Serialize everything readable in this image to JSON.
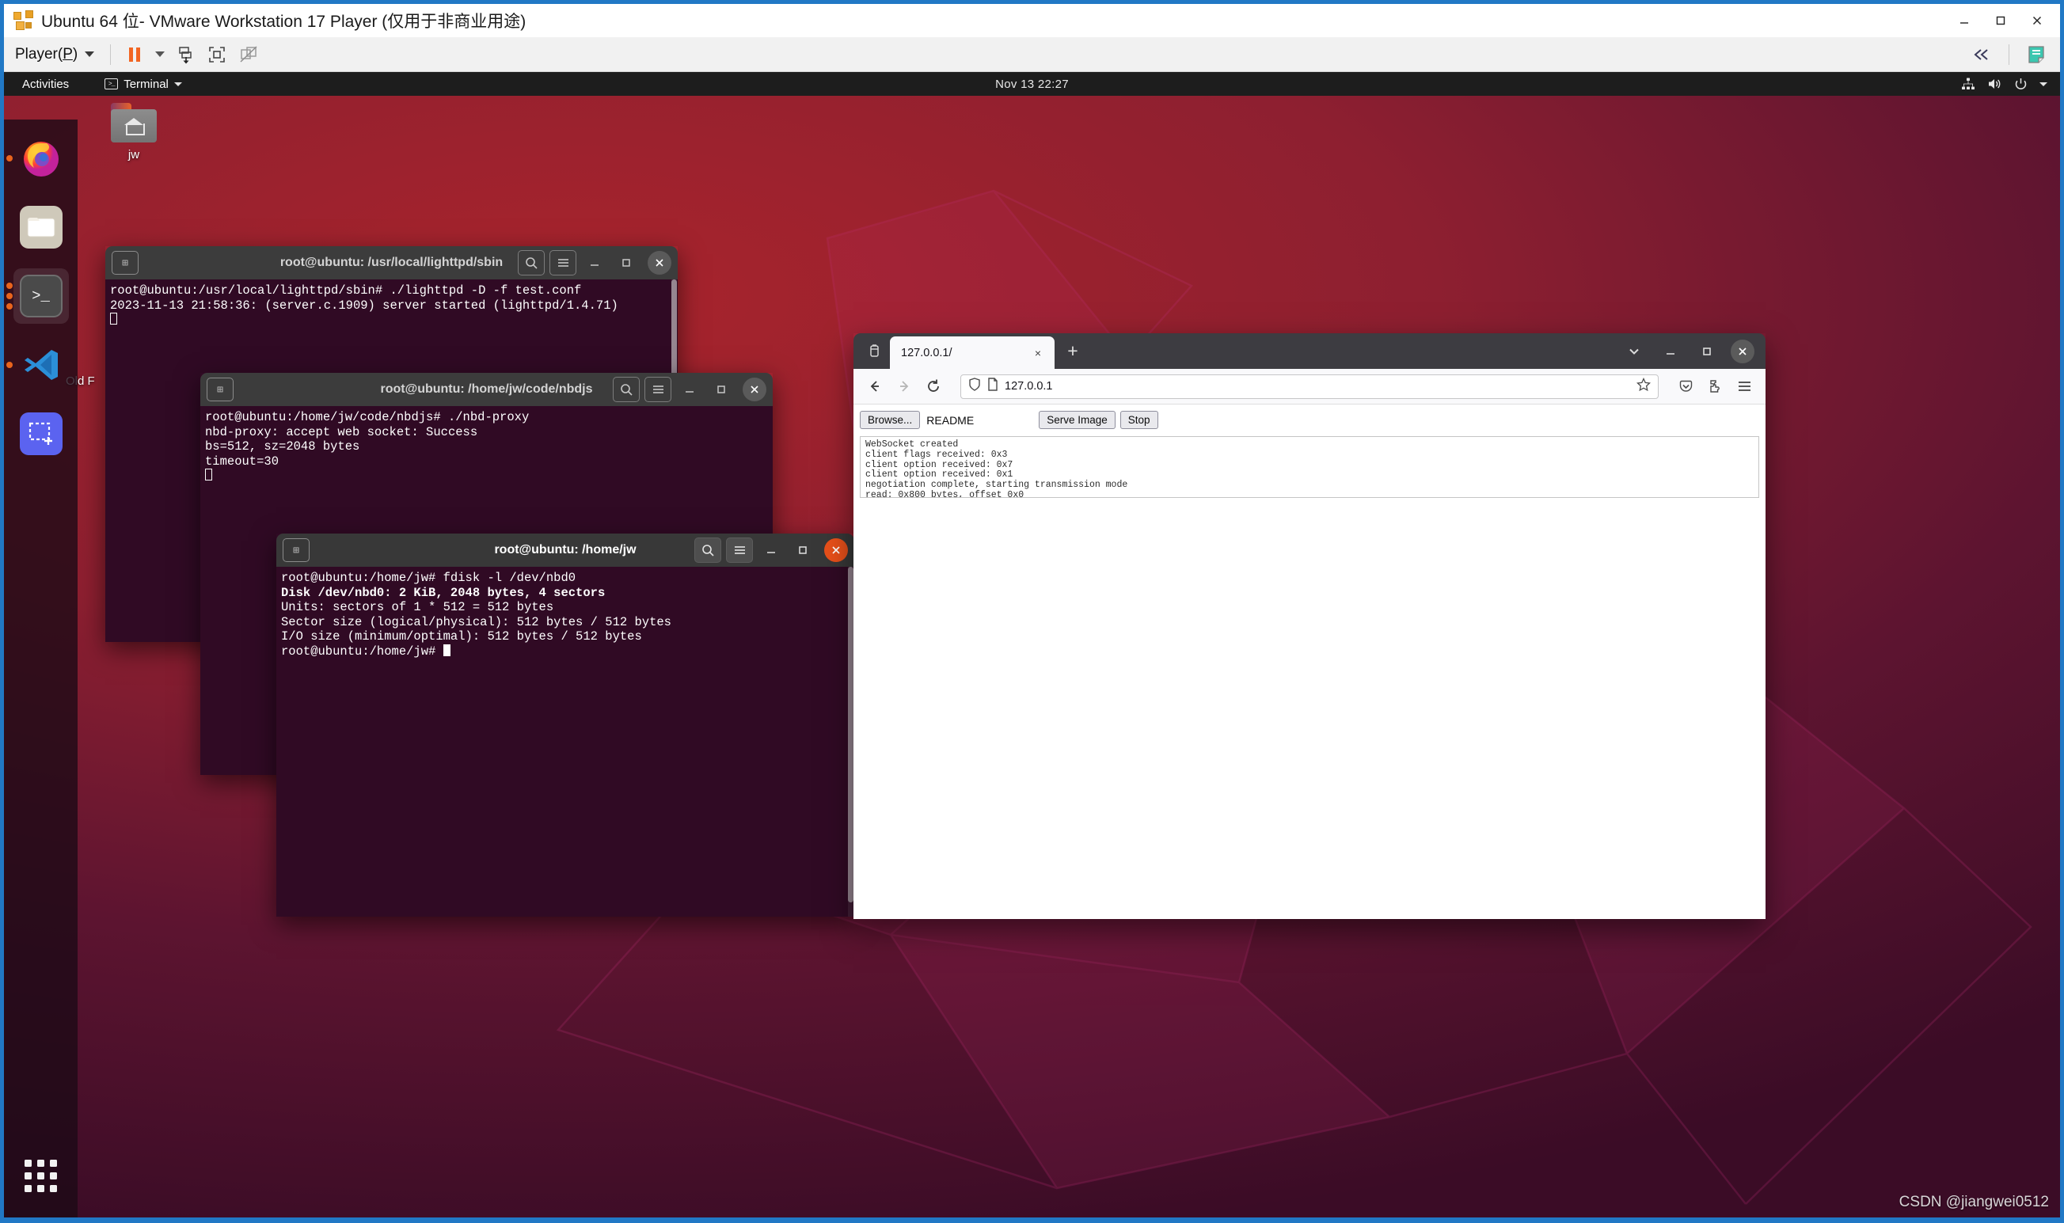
{
  "vmware": {
    "title": "Ubuntu 64 位- VMware Workstation 17 Player (仅用于非商业用途)",
    "menu_label_pre": "Player(",
    "menu_label_key": "P",
    "menu_label_post": ")",
    "icons": {
      "app": "vmware-logo-icon",
      "pause": "pause-icon",
      "dropdown": "caret-down-icon",
      "snapshot": "send-ctrl-alt-del-icon",
      "fullscreen": "enter-fullscreen-icon",
      "unity": "unity-mode-disabled-icon",
      "collapse": "collapse-toolbar-icon",
      "help": "help-notes-icon",
      "minimize": "minimize-icon",
      "maximize": "maximize-icon",
      "close": "close-icon"
    }
  },
  "gnome": {
    "activities": "Activities",
    "app_menu": "Terminal",
    "clock": "Nov 13  22:27",
    "tray": [
      "network-icon",
      "volume-icon",
      "power-icon",
      "caret-down-icon"
    ]
  },
  "dock": {
    "items": [
      {
        "name": "firefox",
        "label": "Firefox",
        "running": true,
        "dots": 1,
        "active": false
      },
      {
        "name": "files",
        "label": "Files",
        "running": false,
        "dots": 0,
        "active": false
      },
      {
        "name": "terminal",
        "label": "Terminal",
        "running": true,
        "dots": 3,
        "active": true
      },
      {
        "name": "vscode",
        "label": "Visual Studio Code",
        "running": true,
        "dots": 1,
        "active": false
      },
      {
        "name": "screenshot",
        "label": "Screenshot",
        "running": false,
        "dots": 0,
        "active": false
      }
    ],
    "show_apps": "Show Applications"
  },
  "desktop_icons": [
    {
      "label": "jw",
      "type": "home-folder"
    },
    {
      "label": "Old F",
      "type": "folder"
    }
  ],
  "terminals": [
    {
      "title": "root@ubuntu: /usr/local/lighttpd/sbin",
      "focused": false,
      "lines": [
        {
          "text": "root@ubuntu:/usr/local/lighttpd/sbin# ./lighttpd -D -f test.conf",
          "bold": false
        },
        {
          "text": "2023-11-13 21:58:36: (server.c.1909) server started (lighttpd/1.4.71)",
          "bold": false
        }
      ],
      "cursor": "hollow"
    },
    {
      "title": "root@ubuntu: /home/jw/code/nbdjs",
      "focused": false,
      "lines": [
        {
          "text": "root@ubuntu:/home/jw/code/nbdjs# ./nbd-proxy",
          "bold": false
        },
        {
          "text": "nbd-proxy: accept web socket: Success",
          "bold": false
        },
        {
          "text": "bs=512, sz=2048 bytes",
          "bold": false
        },
        {
          "text": "timeout=30",
          "bold": false
        }
      ],
      "cursor": "hollow"
    },
    {
      "title": "root@ubuntu: /home/jw",
      "focused": true,
      "lines": [
        {
          "text": "root@ubuntu:/home/jw# fdisk -l /dev/nbd0",
          "bold": false
        },
        {
          "text": "Disk /dev/nbd0: 2 KiB, 2048 bytes, 4 sectors",
          "bold": true
        },
        {
          "text": "Units: sectors of 1 * 512 = 512 bytes",
          "bold": false
        },
        {
          "text": "Sector size (logical/physical): 512 bytes / 512 bytes",
          "bold": false
        },
        {
          "text": "I/O size (minimum/optimal): 512 bytes / 512 bytes",
          "bold": false
        },
        {
          "text": "root@ubuntu:/home/jw# ",
          "bold": false,
          "cursor": true
        }
      ],
      "cursor": "block"
    }
  ],
  "terminal_titlebar_icons": {
    "new_tab": "new-tab-icon",
    "search": "search-icon",
    "menu": "hamburger-menu-icon",
    "minimize": "minimize-icon",
    "maximize": "maximize-icon",
    "close": "close-icon"
  },
  "firefox": {
    "tab": {
      "title": "127.0.0.1/",
      "close": "×"
    },
    "new_tab": "+",
    "list_all_tabs": "chevron-down-icon",
    "window_controls": {
      "minimize": "−",
      "maximize": "□",
      "close": "×"
    },
    "nav": {
      "back": "back-arrow-icon",
      "forward": "forward-arrow-icon",
      "reload": "reload-icon",
      "shield": "shield-icon",
      "page": "page-icon",
      "url": "127.0.0.1",
      "bookmark": "star-icon",
      "pocket": "pocket-icon",
      "extensions": "extensions-puzzle-icon",
      "app_menu": "hamburger-menu-icon"
    },
    "page": {
      "browse_button": "Browse...",
      "file_name": "README",
      "serve_button": "Serve Image",
      "stop_button": "Stop",
      "log_lines": [
        "WebSocket created",
        "client flags received: 0x3",
        "client option received: 0x7",
        "client option received: 0x1",
        "negotiation complete, starting transmission mode",
        "read: 0x800 bytes, offset 0x0"
      ]
    }
  },
  "watermark": "CSDN @jiangwei0512",
  "colors": {
    "vmware_frame": "#2178c5",
    "terminal_bg": "#300a24",
    "accent_orange": "#e8501a",
    "gnome_bar": "#1d1d1d"
  }
}
